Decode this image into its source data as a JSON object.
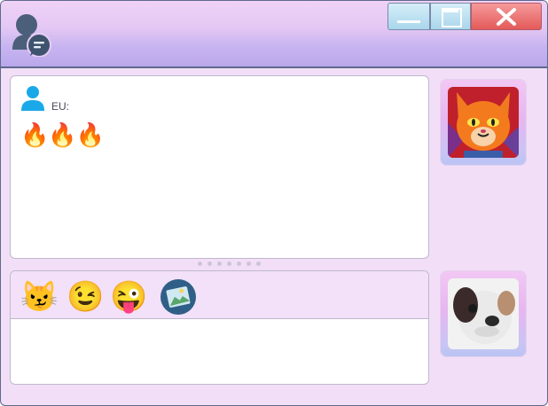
{
  "window": {
    "icon": "contacts-chat-icon",
    "controls": {
      "minimize": "minimize-icon",
      "maximize": "maximize-icon",
      "close": "close-icon"
    }
  },
  "conversation": {
    "messages": [
      {
        "sender": "EU:",
        "content": "🔥🔥🔥"
      }
    ]
  },
  "compose": {
    "emoticons": [
      "😼",
      "😉",
      "😜"
    ],
    "image_button_icon": "image-icon",
    "text": ""
  },
  "avatars": {
    "contact": "cat-avatar",
    "self": "dog-avatar"
  },
  "colors": {
    "window_border": "#5d6a8c",
    "titlebar": "#c7b4f0",
    "background": "#f3def8",
    "close_button": "#e45a5a"
  }
}
